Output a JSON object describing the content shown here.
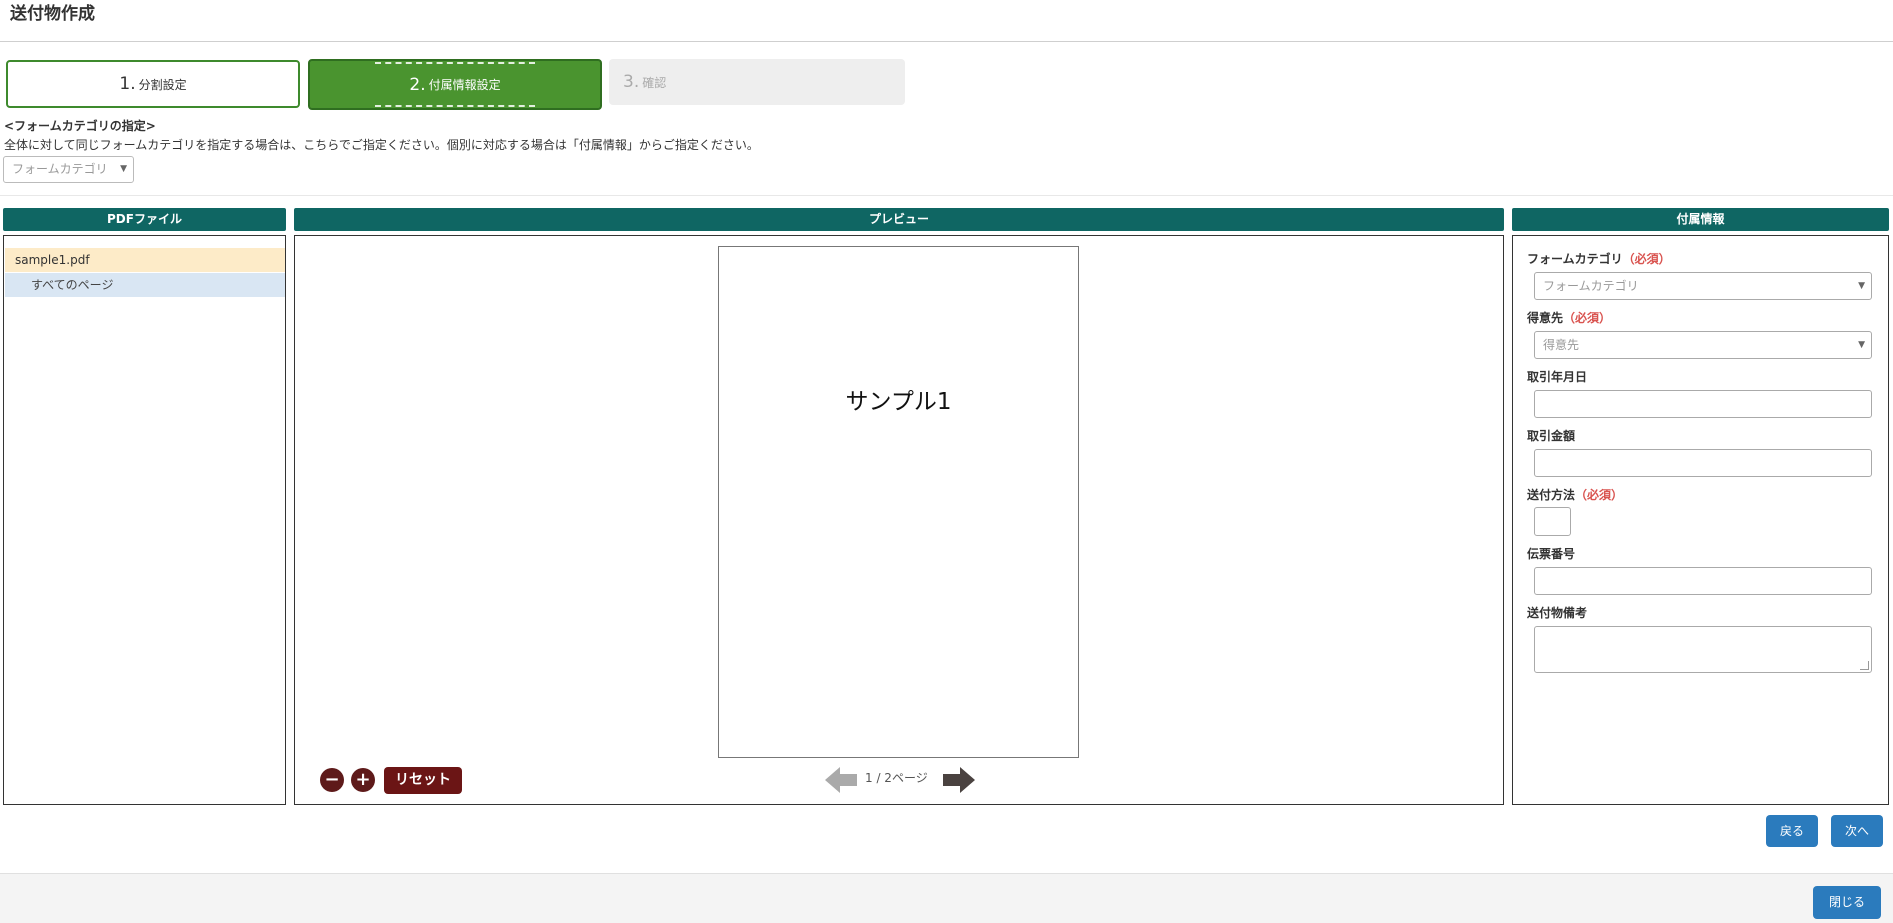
{
  "page": {
    "title": "送付物作成"
  },
  "steps": [
    {
      "number": "1.",
      "label": "分割設定"
    },
    {
      "number": "2.",
      "label": "付属情報設定"
    },
    {
      "number": "3.",
      "label": "確認"
    }
  ],
  "form_category": {
    "heading": "<フォームカテゴリの指定>",
    "description": "全体に対して同じフォームカテゴリを指定する場合は、こちらでご指定ください。個別に対応する場合は「付属情報」からご指定ください。",
    "placeholder": "フォームカテゴリ"
  },
  "pdf_panel": {
    "header": "PDFファイル",
    "file_name": "sample1.pdf",
    "pages_label": "すべてのページ"
  },
  "preview_panel": {
    "header": "プレビュー",
    "page_text": "サンプル1",
    "page_indicator": "1 / 2ページ",
    "reset_label": "リセット"
  },
  "info_panel": {
    "header": "付属情報",
    "required_mark": "（必須）",
    "fields": {
      "form_category": {
        "label": "フォームカテゴリ",
        "placeholder": "フォームカテゴリ"
      },
      "customer": {
        "label": "得意先",
        "placeholder": "得意先"
      },
      "trade_date": {
        "label": "取引年月日"
      },
      "trade_amount": {
        "label": "取引金額"
      },
      "send_method": {
        "label": "送付方法"
      },
      "slip_number": {
        "label": "伝票番号"
      },
      "remarks": {
        "label": "送付物備考"
      }
    }
  },
  "actions": {
    "back": "戻る",
    "next": "次へ",
    "close": "閉じる"
  },
  "colors": {
    "panel_header": "#0f6663",
    "step_active": "#4a942f",
    "button_blue": "#2b7bbd",
    "reset_button": "#6b1515",
    "required": "#d9534f"
  }
}
